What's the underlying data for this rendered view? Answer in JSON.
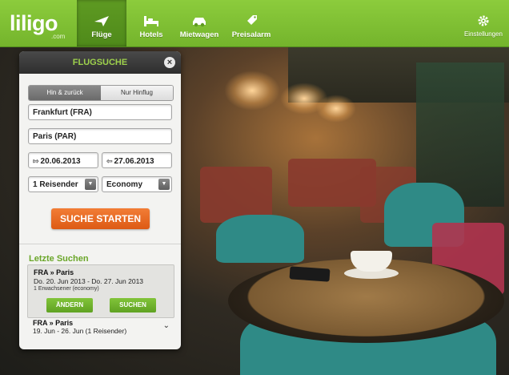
{
  "brand": {
    "name": "liligo",
    "sub": ".com",
    "accent": "#7fc03a"
  },
  "nav": {
    "items": [
      {
        "label": "Flüge",
        "icon": "plane-icon",
        "active": true
      },
      {
        "label": "Hotels",
        "icon": "bed-icon",
        "active": false
      },
      {
        "label": "Mietwagen",
        "icon": "car-icon",
        "active": false
      },
      {
        "label": "Preisalarm",
        "icon": "tag-icon",
        "active": false
      }
    ],
    "settings_label": "Einstellungen"
  },
  "panel": {
    "title": "FLUGSUCHE",
    "close_icon": "×",
    "trip_type": {
      "options": [
        "Hin & zurück",
        "Nur Hinflug"
      ],
      "selected": "Hin & zurück"
    },
    "origin": "Frankfurt (FRA)",
    "destination": "Paris (PAR)",
    "depart_date": "20.06.2013",
    "return_date": "27.06.2013",
    "depart_icon": "⇰",
    "return_icon": "⇦",
    "travelers": "1 Reisender",
    "cabin": "Economy",
    "dropdown_icon": "▼",
    "search_button": "SUCHE STARTEN"
  },
  "recent": {
    "title": "Letzte Suchen",
    "items": [
      {
        "route": "FRA » Paris",
        "dates": "Do. 20. Jun 2013 - Do. 27. Jun 2013",
        "travelers": "1 Erwachsener (economy)",
        "change_label": "ÄNDERN",
        "search_label": "SUCHEN"
      },
      {
        "route": "FRA » Paris",
        "summary": "19. Jun - 26. Jun (1 Reisender)",
        "chevron": "⌄"
      }
    ]
  }
}
